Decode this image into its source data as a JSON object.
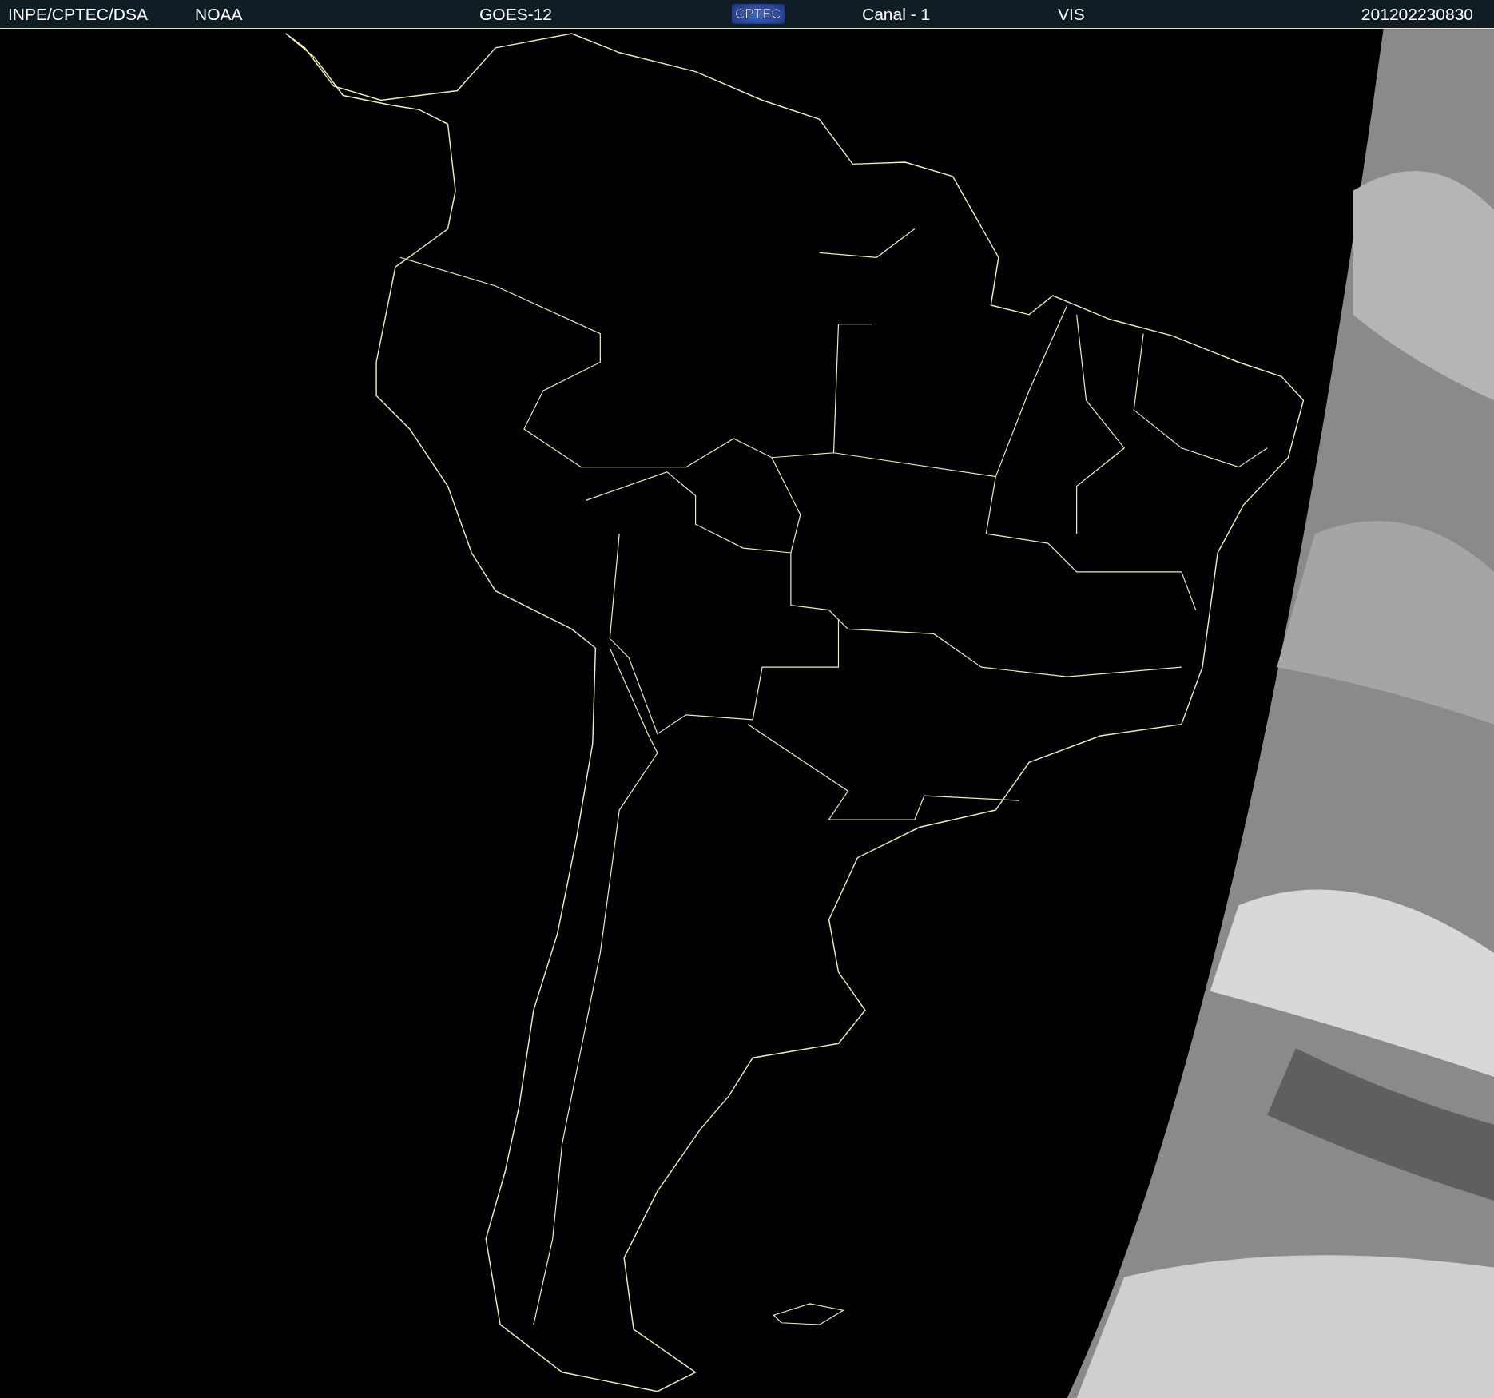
{
  "header": {
    "items": [
      {
        "kind": "text",
        "text": "INPE/CPTEC/DSA"
      },
      {
        "kind": "text",
        "text": "NOAA"
      },
      {
        "kind": "text",
        "text": "GOES-12"
      },
      {
        "kind": "logo",
        "text": "CPTEC"
      },
      {
        "kind": "text",
        "text": "Canal - 1"
      },
      {
        "kind": "text",
        "text": "VIS"
      },
      {
        "kind": "text",
        "text": "201202230830"
      }
    ]
  }
}
